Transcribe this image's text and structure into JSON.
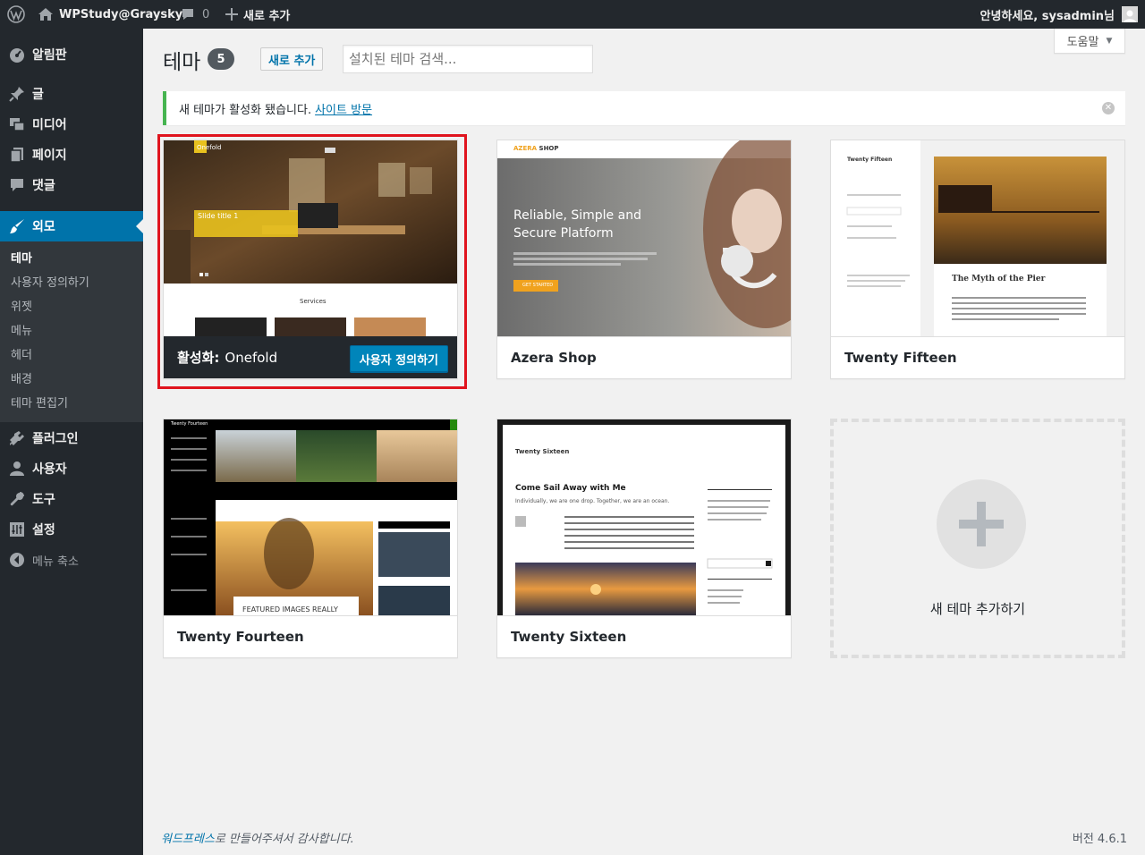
{
  "admin_bar": {
    "site_name": "WPStudy@Graysky",
    "comments_count": "0",
    "new_label": "새로 추가",
    "greeting": "안녕하세요, sysadmin님"
  },
  "sidebar": {
    "dashboard": "알림판",
    "posts": "글",
    "media": "미디어",
    "pages": "페이지",
    "comments": "댓글",
    "appearance": "외모",
    "appearance_sub": [
      "테마",
      "사용자 정의하기",
      "위젯",
      "메뉴",
      "헤더",
      "배경",
      "테마 편집기"
    ],
    "plugins": "플러그인",
    "users": "사용자",
    "tools": "도구",
    "settings": "설정",
    "collapse": "메뉴 축소"
  },
  "header": {
    "title": "테마",
    "count": "5",
    "add_new": "새로 추가",
    "search_placeholder": "설치된 테마 검색...",
    "help": "도움말"
  },
  "notice": {
    "message": "새 테마가 활성화 됐습니다.",
    "link": "사이트 방문"
  },
  "themes": [
    {
      "name": "Onefold",
      "active_prefix": "활성화:",
      "action": "사용자 정의하기",
      "shot": {
        "badge": "Onefold",
        "slide": "Slide title 1",
        "section": "Services"
      }
    },
    {
      "name": "Azera Shop",
      "shot": {
        "logo_a": "AZERA",
        "logo_b": "SHOP",
        "headline_1": "Reliable, Simple and",
        "headline_2": "Secure Platform",
        "cta": "GET STARTED"
      }
    },
    {
      "name": "Twenty Fifteen",
      "shot": {
        "site": "Twenty Fifteen",
        "post_title": "The Myth of the Pier"
      }
    },
    {
      "name": "Twenty Fourteen",
      "shot": {
        "site": "Twenty Fourteen",
        "featured": "FEATURED IMAGES REALLY"
      }
    },
    {
      "name": "Twenty Sixteen",
      "shot": {
        "site": "Twenty Sixteen",
        "post_title": "Come Sail Away with Me",
        "excerpt": "Individually, we are one drop. Together, we are an ocean."
      }
    }
  ],
  "add_theme_label": "새 테마 추가하기",
  "footer": {
    "link": "워드프레스",
    "text": "로 만들어주셔서 감사합니다.",
    "version": "버전 4.6.1"
  },
  "colors": {
    "admin_bg": "#23282d",
    "accent": "#0073aa",
    "active_outline": "#e0141e",
    "notice_success": "#46b450"
  }
}
